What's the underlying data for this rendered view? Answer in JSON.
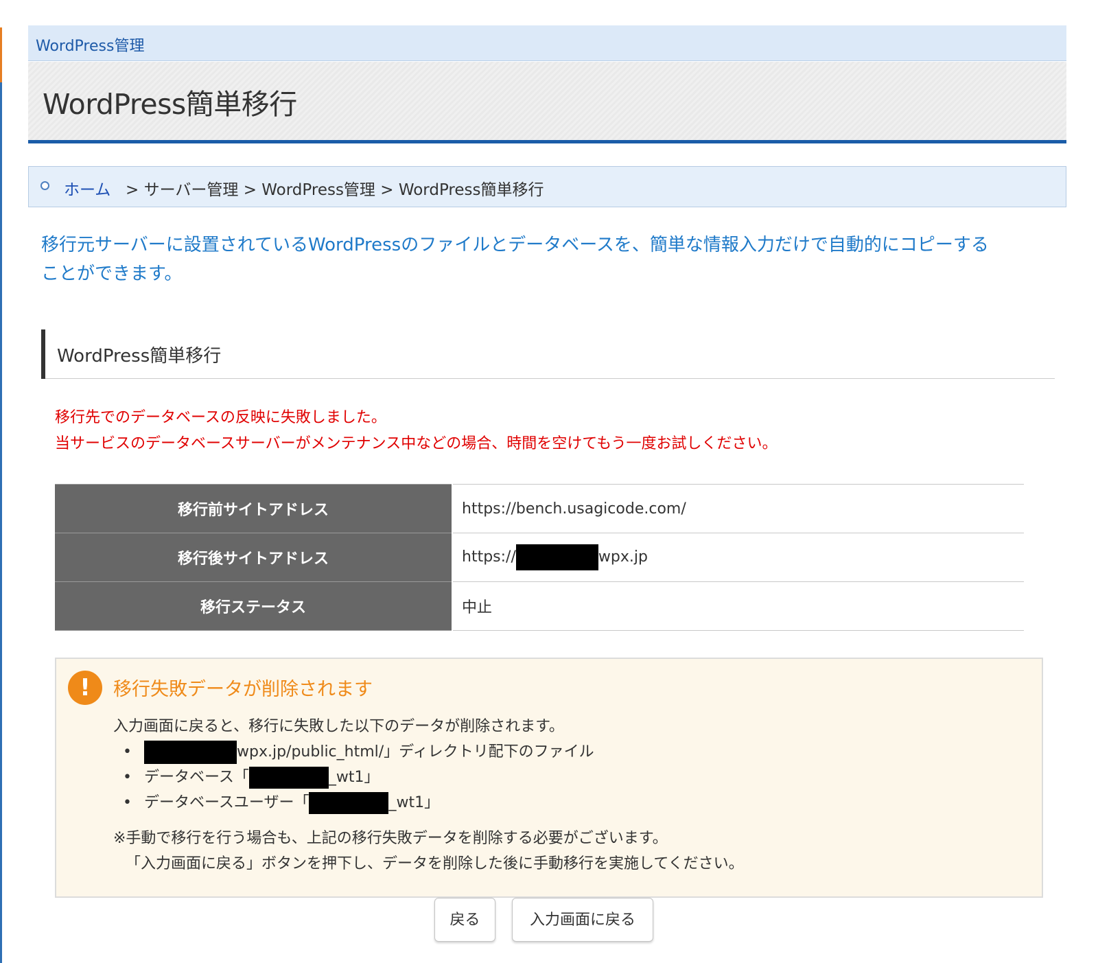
{
  "category_bar": {
    "label": "WordPress管理"
  },
  "page": {
    "title": "WordPress簡単移行"
  },
  "breadcrumb": {
    "home": "ホーム",
    "separator": ">",
    "items": [
      "サーバー管理",
      "WordPress管理",
      "WordPress簡単移行"
    ]
  },
  "intro": {
    "line1": "移行元サーバーに設置されているWordPressのファイルとデータベースを、簡単な情報入力だけで自動的にコピーする",
    "line2": "ことができます。"
  },
  "section": {
    "title": "WordPress簡単移行"
  },
  "error": {
    "line1": "移行先でのデータベースの反映に失敗しました。",
    "line2": "当サービスのデータベースサーバーがメンテナンス中などの場合、時間を空けてもう一度お試しください。"
  },
  "table": {
    "rows": [
      {
        "label": "移行前サイトアドレス",
        "value": "https://bench.usagicode.com/"
      },
      {
        "label": "移行後サイトアドレス",
        "prefix": "https://",
        "suffix": "wpx.jp"
      },
      {
        "label": "移行ステータス",
        "value": "中止"
      }
    ]
  },
  "warning": {
    "icon": "exclamation-icon",
    "title": "移行失敗データが削除されます",
    "intro": "入力画面に戻ると、移行に失敗した以下のデータが削除されます。",
    "bullet": "•",
    "items": [
      {
        "prefix": "",
        "suffix": "wpx.jp/public_html/」ディレクトリ配下のファイル"
      },
      {
        "prefix": "データベース「",
        "suffix": "_wt1」"
      },
      {
        "prefix": "データベースユーザー「",
        "suffix": "_wt1」"
      }
    ],
    "note1": "※手動で移行を行う場合も、上記の移行失敗データを削除する必要がございます。",
    "note2": "「入力画面に戻る」ボタンを押下し、データを削除した後に手動移行を実施してください。"
  },
  "buttons": {
    "back": "戻る",
    "to_input": "入力画面に戻る"
  },
  "colors": {
    "accent_blue": "#1a5ca8",
    "intro_text": "#1f7ac9",
    "error_text": "#e00000",
    "warning_orange": "#ef8a19",
    "table_header": "#676767",
    "warning_bg": "#fdf7ea"
  }
}
